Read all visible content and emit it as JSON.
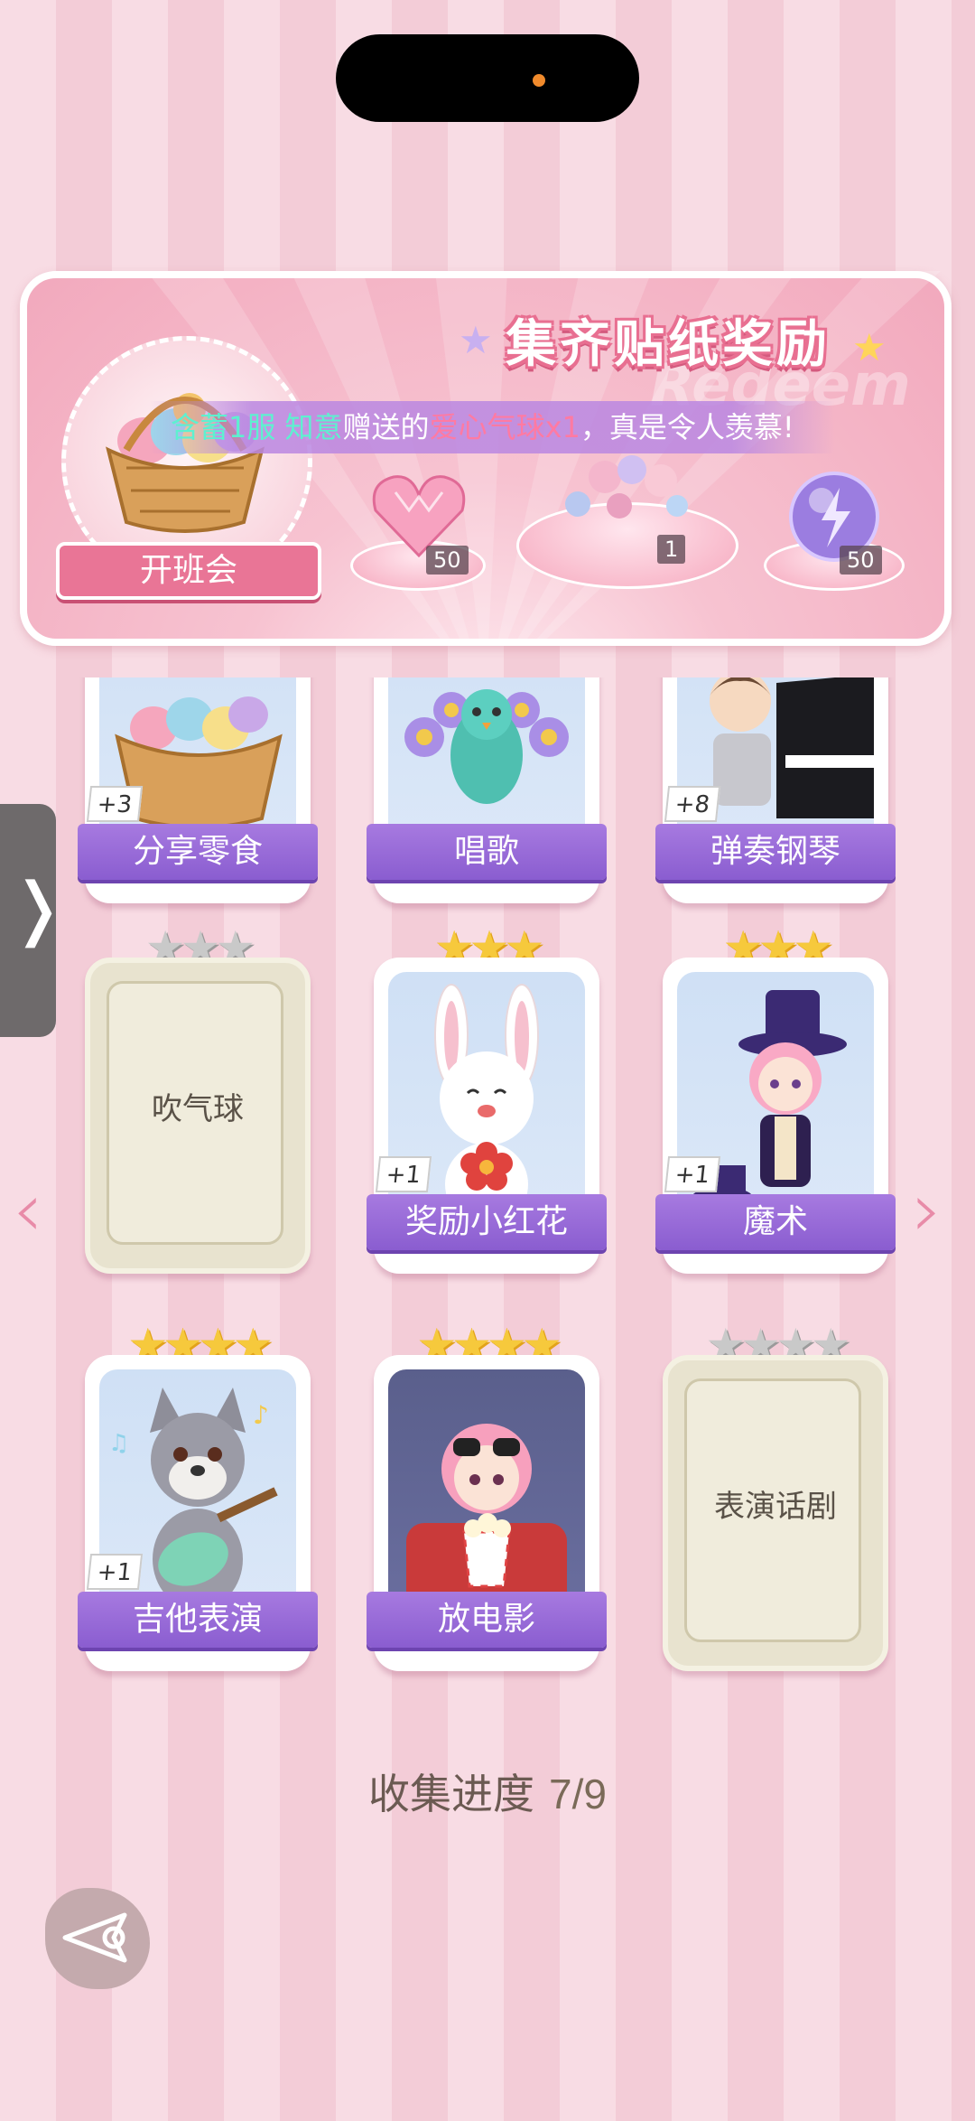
{
  "banner": {
    "title": "集齐贴纸奖励",
    "watermark": "Redeem",
    "event_button": "开班会",
    "marquee": {
      "user": "含蓄1服 知意",
      "middle": "赠送的",
      "item": "爱心气球x1",
      "tail": "，真是令人羡慕!"
    },
    "rewards": [
      {
        "icon": "heart-crystal-icon",
        "count": "50"
      },
      {
        "icon": "balloon-bundle-icon",
        "count": "1"
      },
      {
        "icon": "energy-orb-icon",
        "count": "50"
      }
    ]
  },
  "cards": [
    {
      "label": "分享零食",
      "bonus": "+3",
      "stars": 0,
      "locked": false,
      "art": "snack-basket-art"
    },
    {
      "label": "唱歌",
      "bonus": "",
      "stars": 0,
      "locked": false,
      "art": "peacock-singing-art"
    },
    {
      "label": "弹奏钢琴",
      "bonus": "+8",
      "stars": 0,
      "locked": false,
      "art": "piano-boy-art"
    },
    {
      "label": "吹气球",
      "bonus": "",
      "stars": 3,
      "locked": true
    },
    {
      "label": "奖励小红花",
      "bonus": "+1",
      "stars": 3,
      "locked": false,
      "art": "bunny-flower-art"
    },
    {
      "label": "魔术",
      "bonus": "+1",
      "stars": 3,
      "locked": false,
      "art": "magician-girl-art"
    },
    {
      "label": "吉他表演",
      "bonus": "+1",
      "stars": 4,
      "locked": false,
      "art": "wolf-guitar-art"
    },
    {
      "label": "放电影",
      "bonus": "",
      "stars": 4,
      "locked": false,
      "art": "movie-girl-art"
    },
    {
      "label": "表演话剧",
      "bonus": "",
      "stars": 4,
      "locked": true
    }
  ],
  "progress": {
    "label": "收集进度",
    "value": "7/9",
    "collected": 7,
    "total": 9
  },
  "colors": {
    "label_purple": "#8a5dd0",
    "star_gold": "#f6c93c",
    "star_grey": "#c9c9c9",
    "accent_pink": "#e97596"
  }
}
